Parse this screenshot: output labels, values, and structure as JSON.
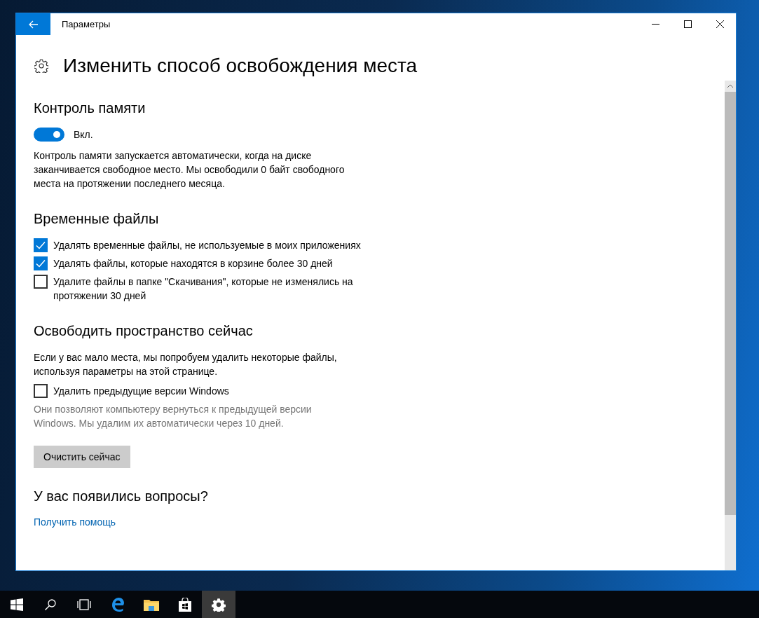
{
  "window": {
    "title": "Параметры"
  },
  "page": {
    "title": "Изменить способ освобождения места"
  },
  "sections": [
    {
      "heading": "Контроль памяти",
      "items": [
        {
          "kind": "toggle",
          "on": true,
          "label": "Вкл."
        },
        {
          "kind": "text",
          "text": "Контроль памяти запускается автоматически, когда на диске заканчивается свободное место. Мы освободили 0 байт свободного места на протяжении последнего месяца."
        }
      ]
    },
    {
      "heading": "Временные файлы",
      "items": [
        {
          "kind": "checkbox",
          "checked": true,
          "label": "Удалять временные файлы, не используемые в моих приложениях"
        },
        {
          "kind": "checkbox",
          "checked": true,
          "label": "Удалять файлы, которые находятся в корзине более 30 дней"
        },
        {
          "kind": "checkbox",
          "checked": false,
          "label": "Удалите файлы в папке \"Скачивания\", которые не изменялись на протяжении 30 дней"
        }
      ]
    },
    {
      "heading": "Освободить пространство сейчас",
      "items": [
        {
          "kind": "text",
          "text": "Если у вас мало места, мы попробуем удалить некоторые файлы, используя параметры на этой странице."
        },
        {
          "kind": "checkbox",
          "checked": false,
          "label": "Удалить предыдущие версии Windows"
        },
        {
          "kind": "note",
          "text": "Они позволяют компьютеру вернуться к предыдущей версии Windows. Мы удалим их автоматически через 10 дней."
        },
        {
          "kind": "button",
          "label": "Очистить сейчас"
        }
      ]
    },
    {
      "heading": "У вас появились вопросы?",
      "items": [
        {
          "kind": "link",
          "label": "Получить помощь"
        }
      ]
    }
  ],
  "taskbar": {
    "items": [
      {
        "kind": "start",
        "selected": false
      },
      {
        "kind": "search",
        "selected": false
      },
      {
        "kind": "taskview",
        "selected": false
      },
      {
        "kind": "edge",
        "selected": false
      },
      {
        "kind": "folder",
        "selected": false
      },
      {
        "kind": "store",
        "selected": false
      },
      {
        "kind": "settings",
        "selected": true
      }
    ]
  }
}
